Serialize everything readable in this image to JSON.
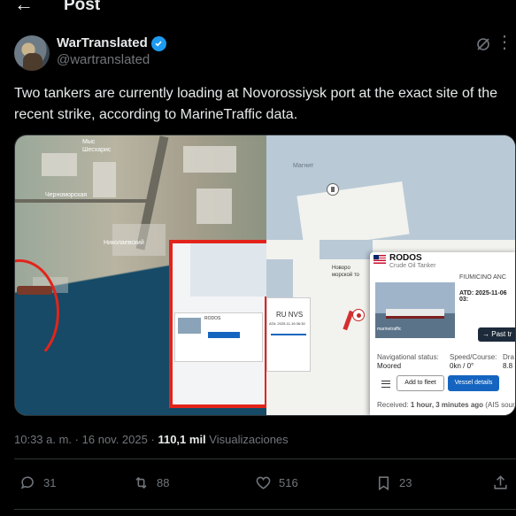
{
  "header": {
    "back_icon": "arrow-left-icon",
    "title": "Post"
  },
  "author": {
    "name": "WarTranslated",
    "handle": "@wartranslated",
    "verified": true
  },
  "post": {
    "text": "Two tankers are currently loading at Novorossiysk port at the exact site of the recent strike, according to MarineTraffic data."
  },
  "media": {
    "satellite_labels": [
      "Мыс",
      "Шесхарис",
      "Черноморская",
      "Николаевский"
    ],
    "map_label_sea": "Магнит",
    "map_label_port": "Новоро морской то",
    "minicard_name": "RU NVS",
    "minicard_atd": "ATA: 2025-11-16 06:30",
    "vessel": {
      "name": "RODOS",
      "type": "Crude Oil Tanker",
      "destination": "FIUMICINO ANC",
      "atd": "ATD: 2025-11-06 03:",
      "photo_credit": "marinetraffic",
      "past_track": "Past tr",
      "nav_status_label": "Navigational status:",
      "nav_status_value": "Moored",
      "speed_label": "Speed/Course:",
      "speed_value": "0kn / 0°",
      "draught_label": "Dra",
      "draught_value": "8.8",
      "add_to_fleet": "Add to fleet",
      "vessel_details": "Vessel details",
      "received_label": "Received:",
      "received_value": "1 hour, 3 minutes ago",
      "received_source": "(AIS source: T"
    }
  },
  "meta": {
    "time": "10:33 a. m.",
    "sep": "·",
    "date": "16 nov. 2025",
    "views_count": "110,1 mil",
    "views_label": "Visualizaciones"
  },
  "actions": {
    "replies": "31",
    "reposts": "88",
    "likes": "516",
    "bookmarks": "23"
  },
  "colors": {
    "accent": "#1d9bf0",
    "background": "#000000",
    "muted": "#71767b",
    "alert_red": "#e3241b"
  }
}
